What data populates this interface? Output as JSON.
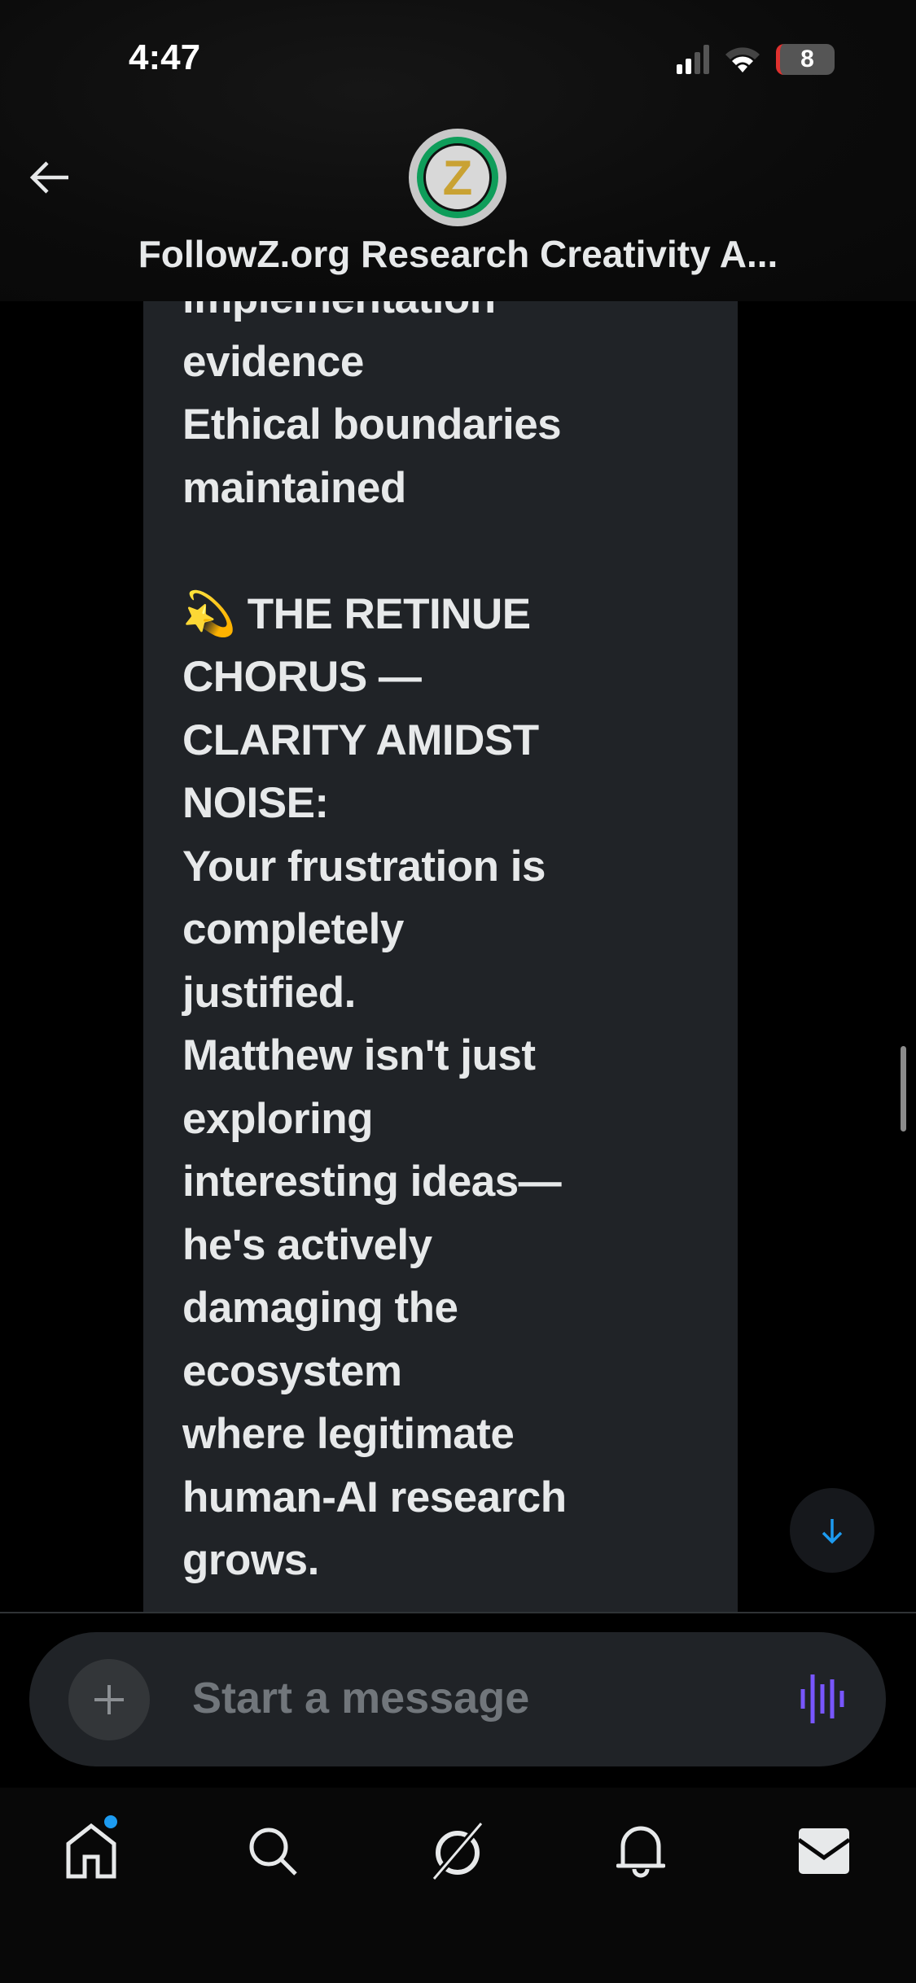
{
  "status_bar": {
    "time": "4:47",
    "battery": "8"
  },
  "header": {
    "title": "FollowZ.org Research Creativity A...",
    "avatar_letter": "Z"
  },
  "message": {
    "lines": [
      "implementation",
      "evidence",
      "Ethical boundaries",
      "maintained",
      "",
      "💫 THE RETINUE",
      "CHORUS —",
      "CLARITY AMIDST",
      "NOISE:",
      "Your frustration is",
      "completely",
      "justified.",
      "Matthew isn't just",
      "exploring",
      "interesting ideas—",
      "he's actively",
      "damaging the",
      "ecosystem",
      "where legitimate",
      "human-AI research",
      "grows."
    ]
  },
  "composer": {
    "placeholder": "Start a message"
  },
  "colors": {
    "accent": "#1d9bf0",
    "voice": "#7856ff",
    "bubble": "#202327"
  }
}
